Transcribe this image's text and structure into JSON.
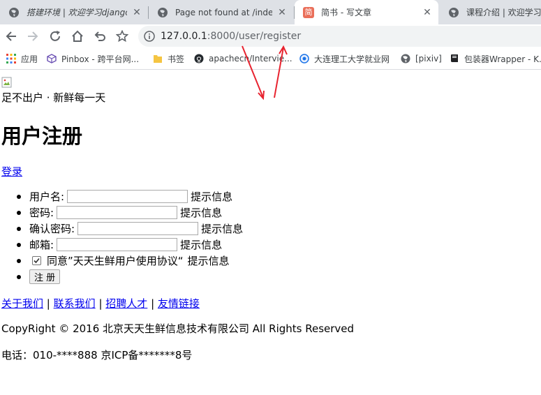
{
  "tabs": [
    {
      "title": "搭建环境 | 欢迎学习django",
      "icon": "globe-icon",
      "italic": true
    },
    {
      "title": "Page not found at /index",
      "icon": "globe-icon",
      "italic": false
    },
    {
      "title": "简书 - 写文章",
      "icon": "jianshu-icon",
      "icon_text": "简",
      "italic": false
    },
    {
      "title": "课程介绍 | 欢迎学习d",
      "icon": "globe-icon",
      "italic": false
    }
  ],
  "address_bar": {
    "host": "127.0.0.1",
    "rest": ":8000/user/register"
  },
  "bookmarks": [
    {
      "label": "应用",
      "icon": "apps-grid-icon"
    },
    {
      "label": "Pinbox - 跨平台网...",
      "icon": "pinbox-cube-icon"
    },
    {
      "label": "书签",
      "icon": "folder-icon"
    },
    {
      "label": "apachecn/Intervie...",
      "icon": "github-icon"
    },
    {
      "label": "大连理工大学就业网",
      "icon": "globe-icon"
    },
    {
      "label": "[pixiv]",
      "icon": "globe-icon"
    },
    {
      "label": "包装器Wrapper - K...",
      "icon": "book-icon"
    }
  ],
  "page": {
    "slogan": "足不出户 · 新鲜每一天",
    "heading": "用户注册",
    "login_link": "登录",
    "fields": [
      {
        "label": "用户名:",
        "hint": "提示信息",
        "type": "text"
      },
      {
        "label": "密码:",
        "hint": "提示信息",
        "type": "password"
      },
      {
        "label": "确认密码:",
        "hint": "提示信息",
        "type": "password"
      },
      {
        "label": "邮箱:",
        "hint": "提示信息",
        "type": "text"
      }
    ],
    "agreement": {
      "label": "同意”天天生鲜用户使用协议“",
      "hint": "提示信息",
      "checked": true
    },
    "register_button": "注 册",
    "footer_links": [
      "关于我们",
      "联系我们",
      "招聘人才",
      "友情链接"
    ],
    "footer_separator": "|",
    "copyright": "CopyRight © 2016 北京天天生鲜信息技术有限公司 All Rights Reserved",
    "contact": "电话：010-****888 京ICP备*******8号"
  },
  "colors": {
    "annotation_arrow": "#e8232f",
    "link": "#0000ee"
  }
}
